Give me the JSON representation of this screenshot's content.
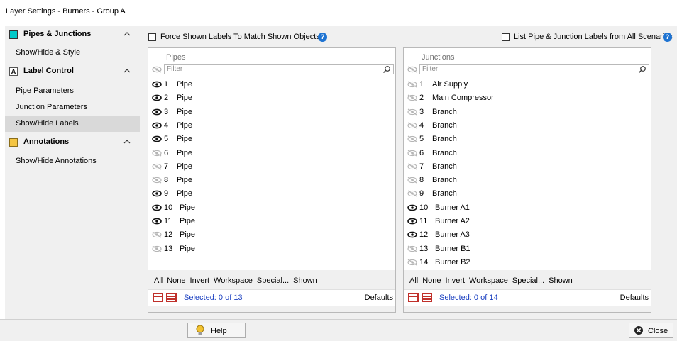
{
  "window": {
    "title": "Layer Settings - Burners - Group A"
  },
  "sidebar": {
    "sections": [
      {
        "label": "Pipes & Junctions",
        "items": [
          "Show/Hide & Style"
        ]
      },
      {
        "label": "Label Control",
        "items": [
          "Pipe Parameters",
          "Junction Parameters",
          "Show/Hide Labels"
        ]
      },
      {
        "label": "Annotations",
        "items": [
          "Show/Hide Annotations"
        ]
      }
    ],
    "selected": "Show/Hide Labels"
  },
  "options": {
    "force_labels": "Force Shown Labels To Match Shown Objects",
    "list_all": "List Pipe & Junction Labels from All Scenarios",
    "help_glyph": "?"
  },
  "pipes": {
    "title": "Pipes",
    "filter_placeholder": "Filter",
    "rows": [
      {
        "num": "1",
        "name": "Pipe",
        "visible": true
      },
      {
        "num": "2",
        "name": "Pipe",
        "visible": true
      },
      {
        "num": "3",
        "name": "Pipe",
        "visible": true
      },
      {
        "num": "4",
        "name": "Pipe",
        "visible": true
      },
      {
        "num": "5",
        "name": "Pipe",
        "visible": true
      },
      {
        "num": "6",
        "name": "Pipe",
        "visible": false
      },
      {
        "num": "7",
        "name": "Pipe",
        "visible": false
      },
      {
        "num": "8",
        "name": "Pipe",
        "visible": false
      },
      {
        "num": "9",
        "name": "Pipe",
        "visible": true
      },
      {
        "num": "10",
        "name": "Pipe",
        "visible": true
      },
      {
        "num": "11",
        "name": "Pipe",
        "visible": true
      },
      {
        "num": "12",
        "name": "Pipe",
        "visible": false
      },
      {
        "num": "13",
        "name": "Pipe",
        "visible": false
      }
    ],
    "links": [
      "All",
      "None",
      "Invert",
      "Workspace",
      "Special...",
      "Shown"
    ],
    "selected": "Selected: 0 of 13",
    "defaults": "Defaults"
  },
  "junctions": {
    "title": "Junctions",
    "filter_placeholder": "Filter",
    "rows": [
      {
        "num": "1",
        "name": "Air Supply",
        "visible": false
      },
      {
        "num": "2",
        "name": "Main Compressor",
        "visible": false
      },
      {
        "num": "3",
        "name": "Branch",
        "visible": false
      },
      {
        "num": "4",
        "name": "Branch",
        "visible": false
      },
      {
        "num": "5",
        "name": "Branch",
        "visible": false
      },
      {
        "num": "6",
        "name": "Branch",
        "visible": false
      },
      {
        "num": "7",
        "name": "Branch",
        "visible": false
      },
      {
        "num": "8",
        "name": "Branch",
        "visible": false
      },
      {
        "num": "9",
        "name": "Branch",
        "visible": false
      },
      {
        "num": "10",
        "name": "Burner A1",
        "visible": true
      },
      {
        "num": "11",
        "name": "Burner A2",
        "visible": true
      },
      {
        "num": "12",
        "name": "Burner A3",
        "visible": true
      },
      {
        "num": "13",
        "name": "Burner B1",
        "visible": false
      },
      {
        "num": "14",
        "name": "Burner B2",
        "visible": false
      }
    ],
    "links": [
      "All",
      "None",
      "Invert",
      "Workspace",
      "Special...",
      "Shown"
    ],
    "selected": "Selected: 0 of 14",
    "defaults": "Defaults"
  },
  "buttons": {
    "help": "Help",
    "close": "Close"
  },
  "colors": {
    "accent": "#1e73d2",
    "selected_text": "#1a3fc0",
    "table_icon": "#c0302a"
  }
}
